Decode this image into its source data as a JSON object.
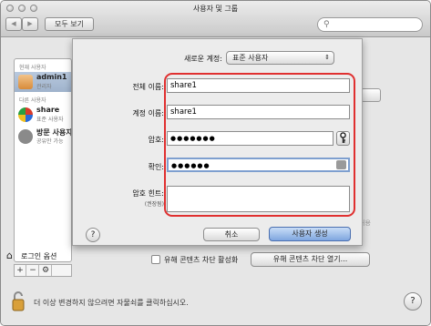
{
  "window": {
    "title": "사용자 및 그룹",
    "show_all_label": "모두 보기",
    "nav_back": "◀",
    "nav_forward": "▶",
    "search_placeholder": ""
  },
  "sidebar": {
    "current_user_header": "현재 사용자",
    "other_users_header": "다른 사용자",
    "items": [
      {
        "name": "admin1",
        "role": "관리자"
      },
      {
        "name": "share",
        "role": "표준 사용자"
      },
      {
        "name": "방문 사용자",
        "role": "공유만 가능"
      }
    ],
    "login_options_label": "로그인 옵션",
    "add_label": "+",
    "remove_label": "−",
    "gear_label": "⚙"
  },
  "main": {
    "faint_text": "허용",
    "parental_controls_checkbox_label": "유해 콘텐츠 차단 활성화",
    "open_parental_controls_label": "유해 콘텐츠 차단 열기..."
  },
  "lockbar": {
    "text": "더 이상 변경하지 않으려면 자물쇠를 클릭하십시오."
  },
  "sheet": {
    "new_account_label": "새로운 계정:",
    "new_account_value": "표준 사용자",
    "full_name_label": "전체 이름:",
    "full_name_value": "share1",
    "account_name_label": "계정 이름:",
    "account_name_value": "share1",
    "password_label": "암호:",
    "password_value": "●●●●●●●",
    "verify_label": "확인:",
    "verify_value": "●●●●●●",
    "hint_label": "암호 힌트:",
    "hint_sublabel": "(권장됨)",
    "hint_value": "",
    "help_label": "?",
    "cancel_label": "취소",
    "create_label": "사용자 생성"
  },
  "colors": {
    "highlight_box": "#e03030",
    "default_button": "#7fa6df"
  }
}
